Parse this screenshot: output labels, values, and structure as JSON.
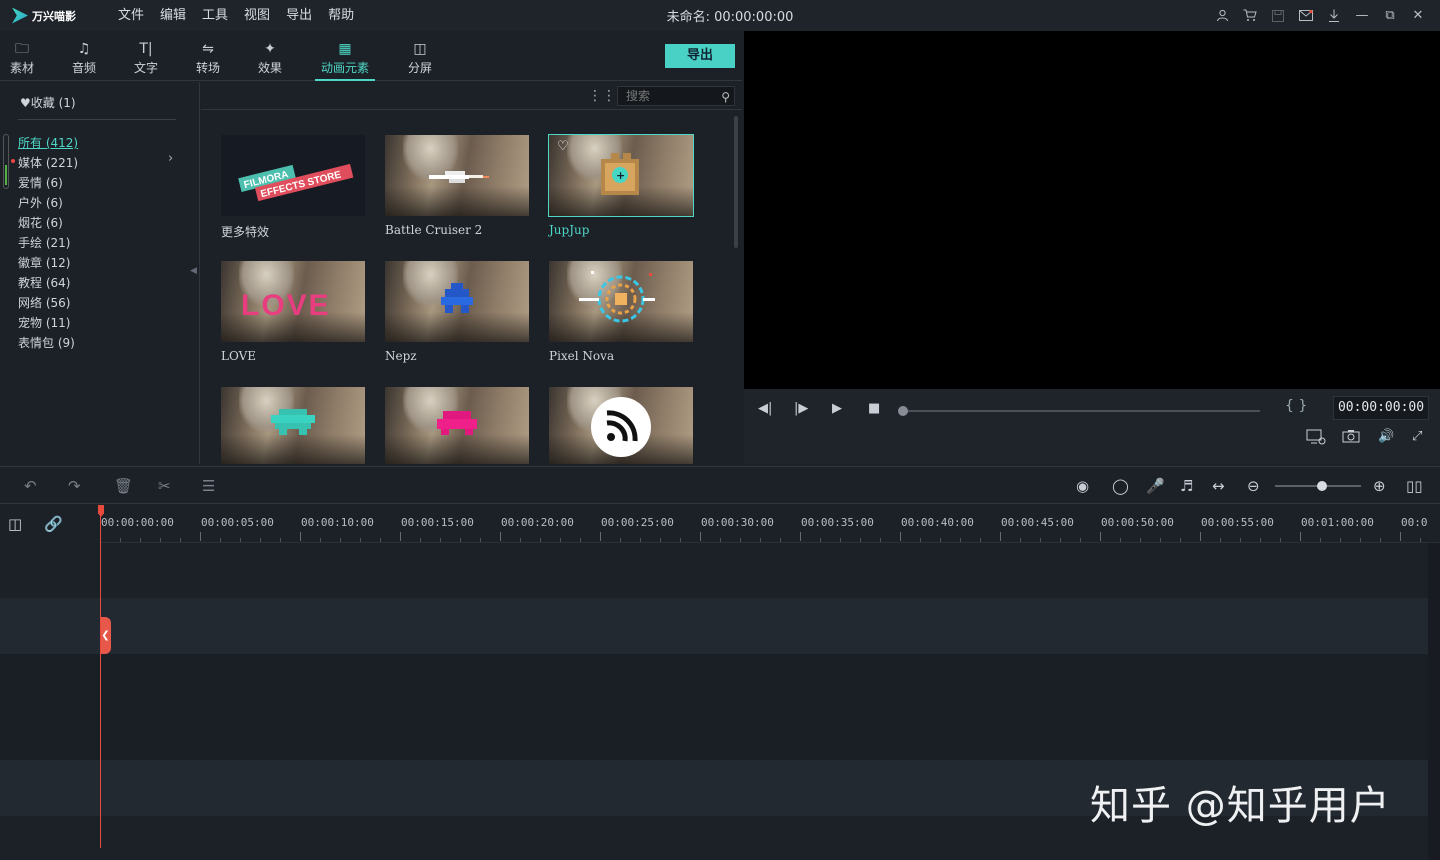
{
  "app": {
    "logo_text": "万兴喵影",
    "menu": [
      "文件",
      "编辑",
      "工具",
      "视图",
      "导出",
      "帮助"
    ],
    "doc_title": "未命名: 00:00:00:00",
    "window_icons": [
      "user-icon",
      "cart-icon",
      "save-icon",
      "mail-icon",
      "download-icon",
      "minimize-icon",
      "restore-icon",
      "close-icon"
    ]
  },
  "tabs": [
    {
      "label": "素材",
      "icon": "folder-icon"
    },
    {
      "label": "音频",
      "icon": "music-icon"
    },
    {
      "label": "文字",
      "icon": "text-icon"
    },
    {
      "label": "转场",
      "icon": "transition-icon"
    },
    {
      "label": "效果",
      "icon": "effects-icon"
    },
    {
      "label": "动画元素",
      "icon": "image-icon",
      "active": true
    },
    {
      "label": "分屏",
      "icon": "splitscreen-icon"
    }
  ],
  "export_label": "导出",
  "sidebar": {
    "favorites": "收藏 (1)",
    "categories": [
      "所有 (412)",
      "媒体 (221)",
      "爱情 (6)",
      "户外 (6)",
      "烟花 (6)",
      "手绘 (21)",
      "徽章 (12)",
      "教程 (64)",
      "网络 (56)",
      "宠物 (11)",
      "表情包 (9)"
    ]
  },
  "search": {
    "placeholder": "搜索"
  },
  "effects_store": {
    "line1": "FILMORA",
    "line2": "EFFECTS STORE"
  },
  "love_text": "LOVE",
  "items": [
    {
      "label": "更多特效"
    },
    {
      "label": "Battle Cruiser 2"
    },
    {
      "label": "JupJup"
    },
    {
      "label": "LOVE"
    },
    {
      "label": "Nepz"
    },
    {
      "label": "Pixel Nova"
    },
    {
      "label": ""
    },
    {
      "label": ""
    },
    {
      "label": ""
    }
  ],
  "player": {
    "timecode": "00:00:00:00",
    "brackets": "{ }",
    "progress": 0
  },
  "timeline": {
    "ruler": [
      "00:00:00:00",
      "00:00:05:00",
      "00:00:10:00",
      "00:00:15:00",
      "00:00:20:00",
      "00:00:25:00",
      "00:00:30:00",
      "00:00:35:00",
      "00:00:40:00",
      "00:00:45:00",
      "00:00:50:00",
      "00:00:55:00",
      "00:01:00:00",
      "00:0"
    ],
    "video_track": "1",
    "audio_track": "1",
    "zoom": 0.55
  },
  "watermark": "知乎 @知乎用户",
  "colors": {
    "accent": "#4ed6c6",
    "export": "#48d1c4",
    "playhead": "#e84a3c"
  }
}
